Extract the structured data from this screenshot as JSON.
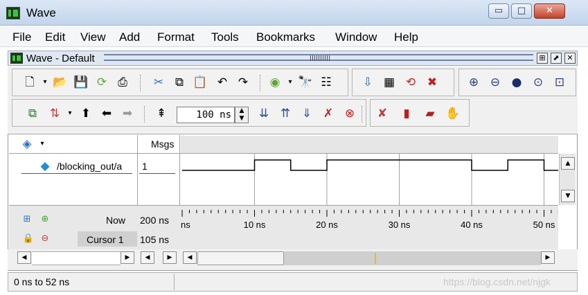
{
  "window": {
    "title": "Wave",
    "minimize_glyph": "▭",
    "maximize_glyph": "□",
    "close_glyph": "✕"
  },
  "menu": [
    "File",
    "Edit",
    "View",
    "Add",
    "Format",
    "Tools",
    "Bookmarks",
    "Window",
    "Help"
  ],
  "panel": {
    "title": "Wave - Default",
    "dock_glyph": "⊞",
    "undock_glyph": "⬈",
    "close_glyph": "✕"
  },
  "toolbar": {
    "time_value": "100 ns",
    "spin_up": "▲",
    "spin_down": "▼"
  },
  "wave": {
    "header_value": "Msgs",
    "signal": {
      "name": "/blocking_out/a",
      "value": "1"
    },
    "now": {
      "label": "Now",
      "value": "200 ns"
    },
    "cursor": {
      "label": "Cursor 1",
      "value": "105 ns"
    },
    "time_axis": {
      "unit": "ns",
      "labels": [
        "ns",
        "10 ns",
        "20 ns",
        "30 ns",
        "40 ns",
        "50 ns"
      ],
      "start": 0,
      "end": 52
    },
    "signal_wave": {
      "transitions_ns": [
        0,
        10,
        15,
        20,
        40,
        45,
        50
      ],
      "levels": [
        0,
        1,
        0,
        1,
        0,
        1,
        0
      ]
    }
  },
  "status": {
    "range": "0 ns to 52 ns",
    "watermark": "https://blog.csdn.net/njgk"
  },
  "colors": {
    "title_gradient_top": "#dbe7f5",
    "close_button": "#c4432a",
    "cursor_marker": "#e6c200",
    "signal_line": "#000000"
  }
}
